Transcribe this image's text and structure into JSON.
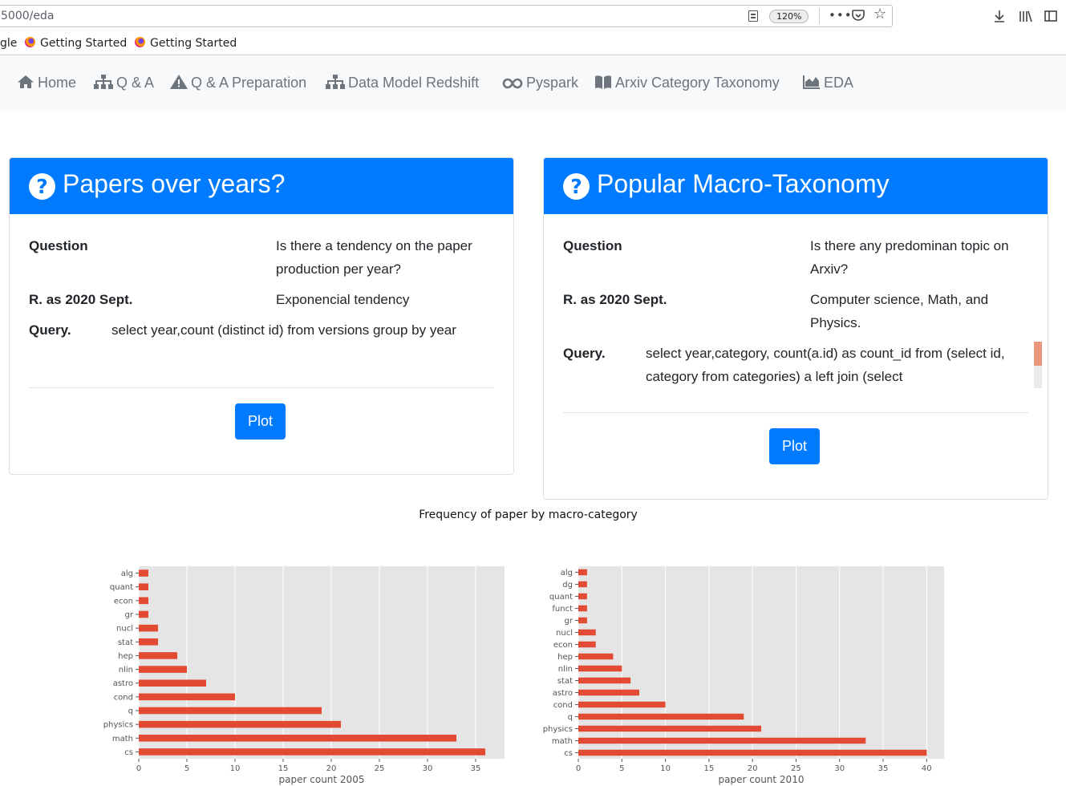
{
  "browser": {
    "url": "5000/eda",
    "zoom": "120%",
    "bookmarks": [
      {
        "label": "gle"
      },
      {
        "label": "Getting Started"
      },
      {
        "label": "Getting Started"
      }
    ]
  },
  "nav": {
    "items": [
      {
        "label": "Home",
        "icon": "home-icon"
      },
      {
        "label": "Q & A",
        "icon": "sitemap-icon"
      },
      {
        "label": "Q & A Preparation",
        "icon": "warning-icon"
      },
      {
        "label": "Data Model Redshift",
        "icon": "sitemap-icon"
      },
      {
        "label": "Pyspark",
        "icon": "infinity-icon"
      },
      {
        "label": "Arxiv Category Taxonomy",
        "icon": "book-icon"
      },
      {
        "label": "EDA",
        "icon": "area-chart-icon"
      }
    ]
  },
  "cards": [
    {
      "title": "Papers over years?",
      "question_label": "Question",
      "question": "Is there a tendency on the paper production per year?",
      "result_label": "R. as 2020 Sept.",
      "result": "Exponencial tendency",
      "query_label": "Query.",
      "query": "select year,count (distinct id) from versions group by year",
      "button": "Plot"
    },
    {
      "title": "Popular Macro-Taxonomy",
      "question_label": "Question",
      "question": "Is there any predominan topic on Arxiv?",
      "result_label": "R. as 2020 Sept.",
      "result": "Computer science, Math, and Physics.",
      "query_label": "Query.",
      "query": "select year,category, count(a.id) as count_id from (select id, category from categories) a left join (select",
      "button": "Plot"
    }
  ],
  "colors": {
    "primary": "#007bff",
    "bar": "#e24a33",
    "plot_bg": "#e5e5e5"
  },
  "figure_title": "Frequency of paper by macro-category",
  "chart_data": [
    {
      "type": "bar",
      "orientation": "horizontal",
      "categories": [
        "alg",
        "quant",
        "econ",
        "gr",
        "nucl",
        "stat",
        "hep",
        "nlin",
        "astro",
        "cond",
        "q",
        "physics",
        "math",
        "cs"
      ],
      "values": [
        1,
        1,
        1,
        1,
        2,
        2,
        4,
        5,
        7,
        10,
        19,
        21,
        33,
        36
      ],
      "xlabel": "paper count 2005",
      "xticks": [
        0,
        5,
        10,
        15,
        20,
        25,
        30,
        35
      ],
      "xlim": [
        0,
        38
      ],
      "grid": true
    },
    {
      "type": "bar",
      "orientation": "horizontal",
      "categories": [
        "alg",
        "dg",
        "quant",
        "funct",
        "gr",
        "nucl",
        "econ",
        "hep",
        "nlin",
        "stat",
        "astro",
        "cond",
        "q",
        "physics",
        "math",
        "cs"
      ],
      "values": [
        1,
        1,
        1,
        1,
        1,
        2,
        2,
        4,
        5,
        6,
        7,
        10,
        19,
        21,
        33,
        40
      ],
      "xlabel": "paper count 2010",
      "xticks": [
        0,
        5,
        10,
        15,
        20,
        25,
        30,
        35,
        40
      ],
      "xlim": [
        0,
        42
      ],
      "grid": true
    }
  ]
}
